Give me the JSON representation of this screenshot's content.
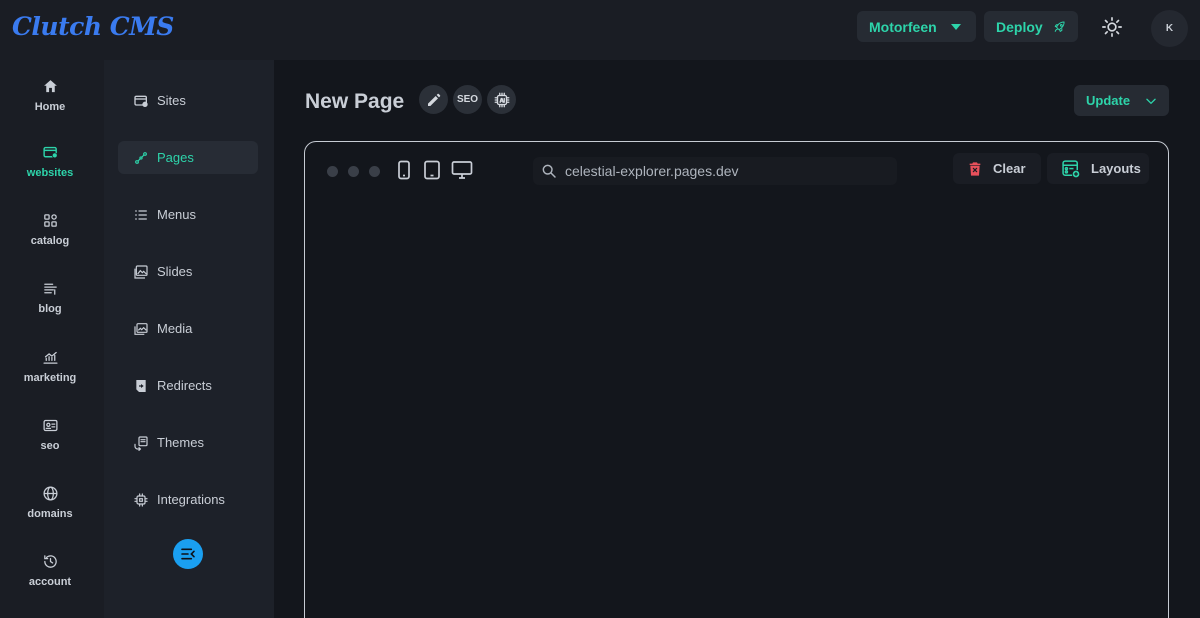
{
  "app": {
    "logo": "Clutch CMS"
  },
  "header": {
    "site_selector": "Motorfeen",
    "deploy_label": "Deploy",
    "avatar_initial": "K"
  },
  "rail": [
    {
      "label": "Home",
      "icon": "home-icon"
    },
    {
      "label": "websites",
      "icon": "website-icon",
      "active": true
    },
    {
      "label": "catalog",
      "icon": "catalog-icon"
    },
    {
      "label": "blog",
      "icon": "blog-icon"
    },
    {
      "label": "marketing",
      "icon": "marketing-icon"
    },
    {
      "label": "seo",
      "icon": "seo-icon"
    },
    {
      "label": "domains",
      "icon": "globe-icon"
    },
    {
      "label": "account",
      "icon": "history-icon"
    }
  ],
  "subnav": [
    {
      "label": "Sites",
      "icon": "sites-icon"
    },
    {
      "label": "Pages",
      "icon": "pages-icon",
      "active": true
    },
    {
      "label": "Menus",
      "icon": "menus-icon"
    },
    {
      "label": "Slides",
      "icon": "slides-icon"
    },
    {
      "label": "Media",
      "icon": "media-icon"
    },
    {
      "label": "Redirects",
      "icon": "redirects-icon"
    },
    {
      "label": "Themes",
      "icon": "themes-icon"
    },
    {
      "label": "Integrations",
      "icon": "integrations-icon"
    }
  ],
  "page": {
    "title": "New Page",
    "seo_label": "SEO",
    "update_label": "Update"
  },
  "browser": {
    "url": "celestial-explorer.pages.dev",
    "clear_label": "Clear",
    "layouts_label": "Layouts"
  },
  "colors": {
    "accent": "#2dd4aa",
    "logo": "#3a7bf0",
    "danger": "#e8505b",
    "collapse": "#1a9ff0"
  }
}
